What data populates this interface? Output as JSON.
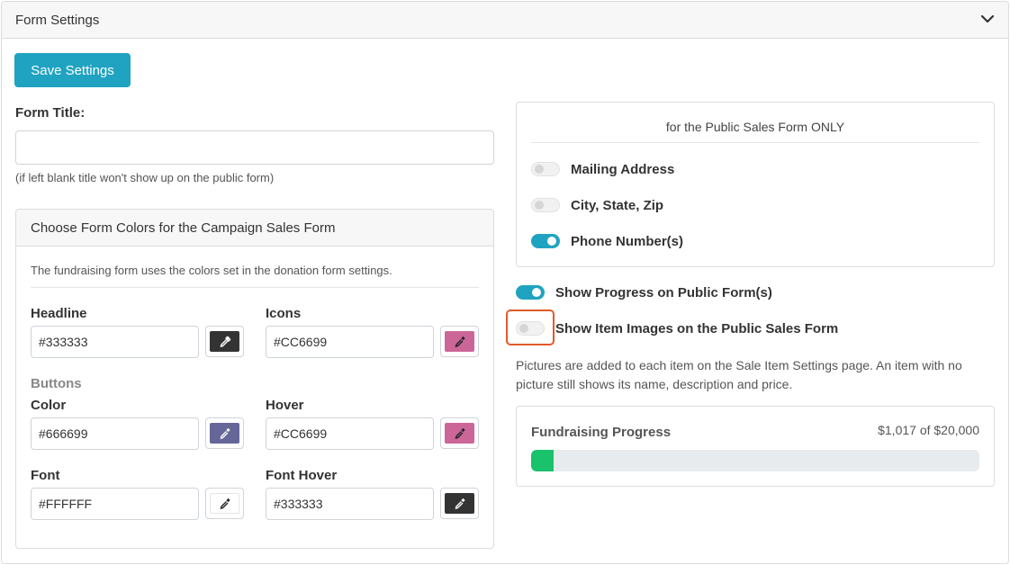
{
  "panel": {
    "title": "Form Settings"
  },
  "save_button": {
    "label": "Save Settings"
  },
  "form_title": {
    "label": "Form Title:",
    "value": "",
    "help": "(if left blank title won't show up on the public form)"
  },
  "colors_card": {
    "title": "Choose Form Colors for the Campaign Sales Form",
    "description": "The fundraising form uses the colors set in the donation form settings.",
    "headline": {
      "label": "Headline",
      "value": "#333333",
      "color": "#333333"
    },
    "icons": {
      "label": "Icons",
      "value": "#CC6699",
      "color": "#CC6699"
    },
    "buttons_heading": "Buttons",
    "color": {
      "label": "Color",
      "value": "#666699",
      "color": "#666699"
    },
    "hover": {
      "label": "Hover",
      "value": "#CC6699",
      "color": "#CC6699"
    },
    "font": {
      "label": "Font",
      "value": "#FFFFFF",
      "color": "#FFFFFF"
    },
    "font_hover": {
      "label": "Font Hover",
      "value": "#333333",
      "color": "#333333"
    }
  },
  "public_form_card": {
    "title": "for the Public Sales Form ONLY",
    "toggles": [
      {
        "label": "Mailing Address",
        "on": false
      },
      {
        "label": "City, State, Zip",
        "on": false
      },
      {
        "label": "Phone Number(s)",
        "on": true
      }
    ]
  },
  "show_progress": {
    "label": "Show Progress on Public Form(s)",
    "on": true
  },
  "show_item_images": {
    "label": "Show Item Images on the Public Sales Form",
    "on": false,
    "help": "Pictures are added to each item on the Sale Item Settings page. An item with no picture still shows its name, description and price."
  },
  "fundraising_progress": {
    "label": "Fundraising Progress",
    "amount_text": "$1,017 of $20,000",
    "raised": 1017,
    "goal": 20000,
    "bar_color": "#19c26b"
  },
  "colors": {
    "accent": "#1fa3c1",
    "highlight": "#e25a2a"
  }
}
